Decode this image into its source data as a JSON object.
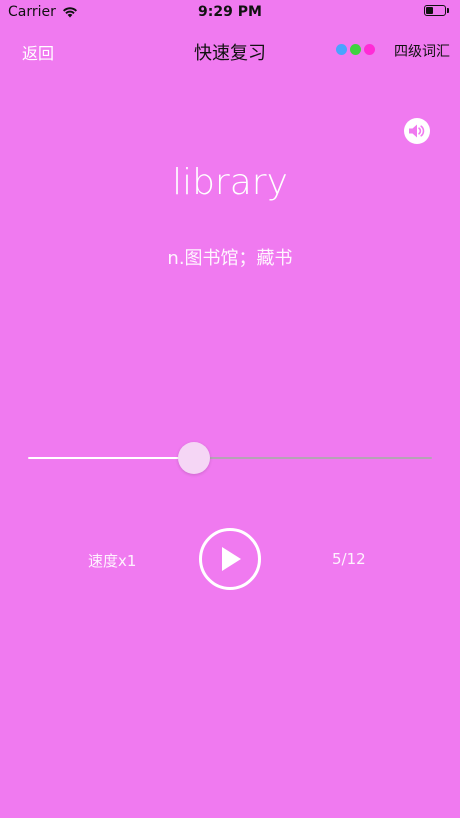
{
  "status_bar": {
    "carrier": "Carrier",
    "time": "9:29 PM",
    "battery_level": 0.4
  },
  "nav": {
    "back_label": "返回",
    "title": "快速复习",
    "word_list_label": "四级词汇",
    "dot_colors": [
      "#4aa3ff",
      "#3fd23f",
      "#ff2bd6"
    ]
  },
  "card": {
    "word": "library",
    "meaning": "n.图书馆；藏书"
  },
  "player": {
    "speed_label": "速度x1",
    "progress_label": "5/12",
    "slider_value": 0.41
  },
  "colors": {
    "background": "#f07af0",
    "accent": "#ffffff"
  },
  "icons": {
    "speaker": "speaker-icon",
    "play": "play-icon",
    "wifi": "wifi-icon",
    "battery": "battery-icon"
  }
}
